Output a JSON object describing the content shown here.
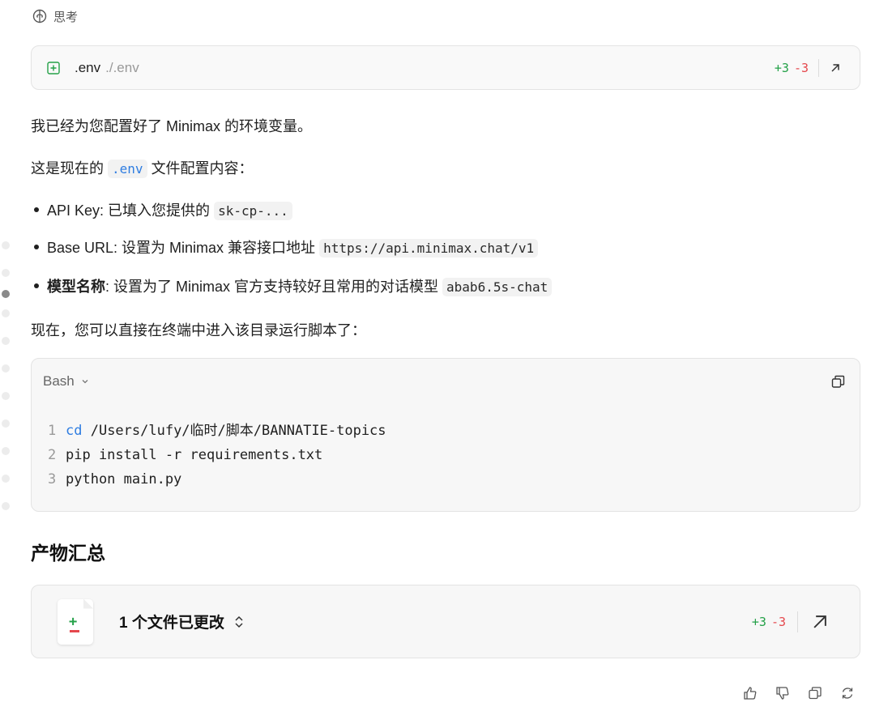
{
  "thinking": {
    "label": "思考"
  },
  "file_card": {
    "name": ".env",
    "path": "./.env",
    "added": "+3",
    "removed": "-3"
  },
  "messages": {
    "intro": "我已经为您配置好了 Minimax 的环境变量。",
    "config_prefix": "这是现在的",
    "config_code": ".env",
    "config_suffix": "文件配置内容："
  },
  "bullets": [
    {
      "label": "API Key",
      "text": ": 已填入您提供的",
      "code": "sk-cp-..."
    },
    {
      "label": "Base URL",
      "text": ": 设置为 Minimax 兼容接口地址",
      "code": "https://api.minimax.chat/v1"
    },
    {
      "label": "模型名称",
      "text": ": 设置为了 Minimax 官方支持较好且常用的对话模型",
      "code": "abab6.5s-chat"
    }
  ],
  "run_text": "现在，您可以直接在终端中进入该目录运行脚本了：",
  "code_block": {
    "language": "Bash",
    "lines": [
      {
        "num": "1",
        "keyword": "cd",
        "rest": " /Users/lufy/临时/脚本/BANNATIE-topics"
      },
      {
        "num": "2",
        "keyword": "",
        "rest": "pip install -r requirements.txt"
      },
      {
        "num": "3",
        "keyword": "",
        "rest": "python main.py"
      }
    ]
  },
  "summary": {
    "heading": "产物汇总",
    "title": "1 个文件已更改",
    "added": "+3",
    "removed": "-3"
  },
  "icons": {
    "thinking": "brain-icon",
    "file_add": "plus-square-icon",
    "open": "arrow-up-right-icon",
    "chevron": "chevron-down-icon",
    "copy": "copy-icon",
    "expand": "chevron-up-down-icon",
    "thumbs_up": "thumbs-up-icon",
    "thumbs_down": "thumbs-down-icon",
    "regenerate": "refresh-icon"
  },
  "colors": {
    "added": "#24a148",
    "removed": "#e5484d",
    "keyword": "#2f7de1"
  }
}
